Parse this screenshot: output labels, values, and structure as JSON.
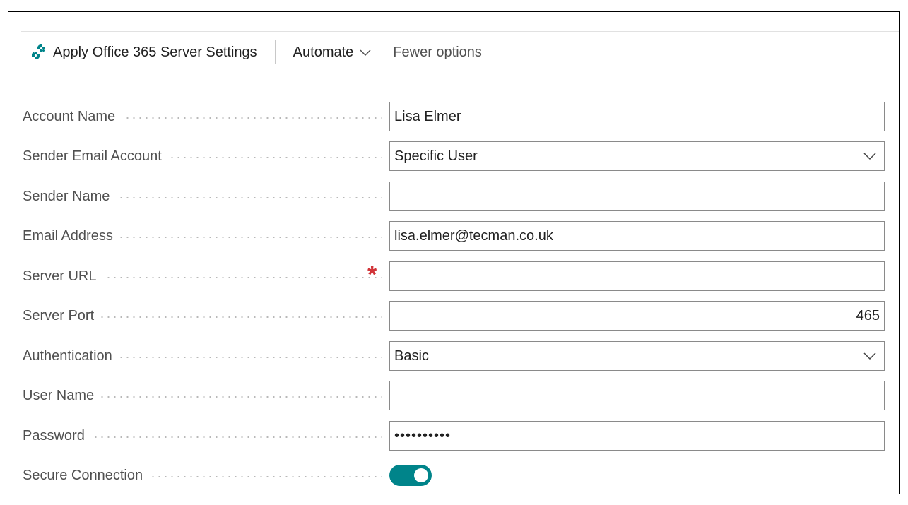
{
  "toolbar": {
    "apply_label": "Apply Office 365 Server Settings",
    "automate_label": "Automate",
    "fewer_label": "Fewer options"
  },
  "colors": {
    "accent": "#00848a",
    "required": "#d13438",
    "label": "#505050"
  },
  "fields": {
    "account_name": {
      "label": "Account Name",
      "value": "Lisa Elmer"
    },
    "sender_email_account": {
      "label": "Sender Email Account",
      "value": "Specific User"
    },
    "sender_name": {
      "label": "Sender Name",
      "value": ""
    },
    "email_address": {
      "label": "Email Address",
      "value": "lisa.elmer@tecman.co.uk"
    },
    "server_url": {
      "label": "Server URL",
      "value": "",
      "required_mark": "*"
    },
    "server_port": {
      "label": "Server Port",
      "value": "465"
    },
    "authentication": {
      "label": "Authentication",
      "value": "Basic"
    },
    "user_name": {
      "label": "User Name",
      "value": ""
    },
    "password": {
      "label": "Password",
      "value": "••••••••••"
    },
    "secure_connection": {
      "label": "Secure Connection",
      "value": "on"
    }
  }
}
